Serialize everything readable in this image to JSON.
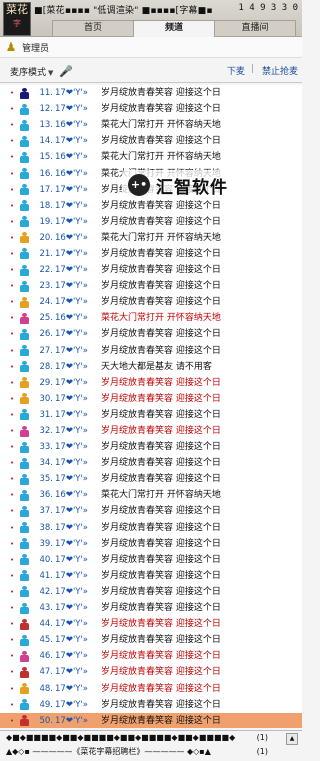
{
  "logo": {
    "text": "菜花",
    "sub": "字"
  },
  "room": {
    "title": "■[菜花▪▪▪▪ \"低调渲染\" ■▪▪▪▪[字幕■▪",
    "number": "1 4 9 3 3 0"
  },
  "tabs": [
    {
      "label": "首页",
      "active": false
    },
    {
      "label": "频道",
      "active": true
    },
    {
      "label": "直播间",
      "active": false
    }
  ],
  "admin": {
    "label": "管理员"
  },
  "toolbar": {
    "mode_label": "麦序模式",
    "down_label": "下麦",
    "ban_label": "禁止抢麦"
  },
  "rows": [
    {
      "num": "11.",
      "name": "17❤'Y'»",
      "sig": "岁月绽放青春笑容 迎接这个日",
      "color": "#1a1a7a",
      "red": false,
      "sel": false
    },
    {
      "num": "12.",
      "name": "17❤'Y'»",
      "sig": "岁月绽放青春笑容 迎接这个日",
      "color": "#2aa8d8",
      "red": false,
      "sel": false
    },
    {
      "num": "13.",
      "name": "16❤'Y'»",
      "sig": "菜花大门常打开 开怀容纳天地",
      "color": "#2aa8d8",
      "red": false,
      "sel": false
    },
    {
      "num": "14.",
      "name": "17❤'Y'»",
      "sig": "岁月绽放青春笑容 迎接这个日",
      "color": "#2aa8d8",
      "red": false,
      "sel": false
    },
    {
      "num": "15.",
      "name": "16❤'Y'»",
      "sig": "菜花大门常打开 开怀容纳天地",
      "color": "#2aa8d8",
      "red": false,
      "sel": false
    },
    {
      "num": "16.",
      "name": "16❤'Y'»",
      "sig": "菜花大门常打开 开怀容纳天地",
      "color": "#2aa8d8",
      "red": false,
      "sel": false
    },
    {
      "num": "17.",
      "name": "17❤'Y'»",
      "sig": "岁月绽放青春笑容 迎接这个日",
      "color": "#2aa8d8",
      "red": false,
      "sel": false
    },
    {
      "num": "18.",
      "name": "17❤'Y'»",
      "sig": "岁月绽放青春笑容 迎接这个日",
      "color": "#2aa8d8",
      "red": false,
      "sel": false
    },
    {
      "num": "19.",
      "name": "17❤'Y'»",
      "sig": "岁月绽放青春笑容 迎接这个日",
      "color": "#2aa8d8",
      "red": false,
      "sel": false
    },
    {
      "num": "20.",
      "name": "16❤'Y'»",
      "sig": "菜花大门常打开 开怀容纳天地",
      "color": "#e6a020",
      "red": false,
      "sel": false
    },
    {
      "num": "21.",
      "name": "17❤'Y'»",
      "sig": "岁月绽放青春笑容 迎接这个日",
      "color": "#2aa8d8",
      "red": false,
      "sel": false
    },
    {
      "num": "22.",
      "name": "17❤'Y'»",
      "sig": "岁月绽放青春笑容 迎接这个日",
      "color": "#2aa8d8",
      "red": false,
      "sel": false
    },
    {
      "num": "23.",
      "name": "17❤'Y'»",
      "sig": "岁月绽放青春笑容 迎接这个日",
      "color": "#2aa8d8",
      "red": false,
      "sel": false
    },
    {
      "num": "24.",
      "name": "17❤'Y'»",
      "sig": "岁月绽放青春笑容 迎接这个日",
      "color": "#e6a020",
      "red": false,
      "sel": false
    },
    {
      "num": "25.",
      "name": "16❤'Y'»",
      "sig": "菜花大门常打开 开怀容纳天地",
      "color": "#d04090",
      "red": true,
      "sel": false
    },
    {
      "num": "26.",
      "name": "17❤'Y'»",
      "sig": "岁月绽放青春笑容 迎接这个日",
      "color": "#2aa8d8",
      "red": false,
      "sel": false
    },
    {
      "num": "27.",
      "name": "17❤'Y'»",
      "sig": "岁月绽放青春笑容 迎接这个日",
      "color": "#2aa8d8",
      "red": false,
      "sel": false
    },
    {
      "num": "28.",
      "name": "17❤'Y'»",
      "sig": "天大地大都是基友 请不用客",
      "color": "#2aa8d8",
      "red": false,
      "sel": false
    },
    {
      "num": "29.",
      "name": "17❤'Y'»",
      "sig": "岁月绽放青春笑容 迎接这个日",
      "color": "#e6a020",
      "red": true,
      "sel": false
    },
    {
      "num": "30.",
      "name": "17❤'Y'»",
      "sig": "岁月绽放青春笑容 迎接这个日",
      "color": "#e6a020",
      "red": true,
      "sel": false
    },
    {
      "num": "31.",
      "name": "17❤'Y'»",
      "sig": "岁月绽放青春笑容 迎接这个日",
      "color": "#2aa8d8",
      "red": false,
      "sel": false
    },
    {
      "num": "32.",
      "name": "17❤'Y'»",
      "sig": "岁月绽放青春笑容 迎接这个日",
      "color": "#d04090",
      "red": true,
      "sel": false
    },
    {
      "num": "33.",
      "name": "17❤'Y'»",
      "sig": "岁月绽放青春笑容 迎接这个日",
      "color": "#2aa8d8",
      "red": false,
      "sel": false
    },
    {
      "num": "34.",
      "name": "17❤'Y'»",
      "sig": "岁月绽放青春笑容 迎接这个日",
      "color": "#2aa8d8",
      "red": false,
      "sel": false
    },
    {
      "num": "35.",
      "name": "17❤'Y'»",
      "sig": "岁月绽放青春笑容 迎接这个日",
      "color": "#2aa8d8",
      "red": false,
      "sel": false
    },
    {
      "num": "36.",
      "name": "16❤'Y'»",
      "sig": "菜花大门常打开 开怀容纳天地",
      "color": "#2aa8d8",
      "red": false,
      "sel": false
    },
    {
      "num": "37.",
      "name": "17❤'Y'»",
      "sig": "岁月绽放青春笑容 迎接这个日",
      "color": "#2aa8d8",
      "red": false,
      "sel": false
    },
    {
      "num": "38.",
      "name": "17❤'Y'»",
      "sig": "岁月绽放青春笑容 迎接这个日",
      "color": "#2aa8d8",
      "red": false,
      "sel": false
    },
    {
      "num": "39.",
      "name": "17❤'Y'»",
      "sig": "岁月绽放青春笑容 迎接这个日",
      "color": "#2aa8d8",
      "red": false,
      "sel": false
    },
    {
      "num": "40.",
      "name": "17❤'Y'»",
      "sig": "岁月绽放青春笑容 迎接这个日",
      "color": "#2aa8d8",
      "red": false,
      "sel": false
    },
    {
      "num": "41.",
      "name": "17❤'Y'»",
      "sig": "岁月绽放青春笑容 迎接这个日",
      "color": "#2aa8d8",
      "red": false,
      "sel": false
    },
    {
      "num": "42.",
      "name": "17❤'Y'»",
      "sig": "岁月绽放青春笑容 迎接这个日",
      "color": "#2aa8d8",
      "red": false,
      "sel": false
    },
    {
      "num": "43.",
      "name": "17❤'Y'»",
      "sig": "岁月绽放青春笑容 迎接这个日",
      "color": "#2aa8d8",
      "red": false,
      "sel": false
    },
    {
      "num": "44.",
      "name": "17❤'Y'»",
      "sig": "岁月绽放青春笑容 迎接这个日",
      "color": "#c03030",
      "red": true,
      "sel": false
    },
    {
      "num": "45.",
      "name": "17❤'Y'»",
      "sig": "岁月绽放青春笑容 迎接这个日",
      "color": "#2aa8d8",
      "red": false,
      "sel": false
    },
    {
      "num": "46.",
      "name": "17❤'Y'»",
      "sig": "岁月绽放青春笑容 迎接这个日",
      "color": "#d04090",
      "red": true,
      "sel": false
    },
    {
      "num": "47.",
      "name": "17❤'Y'»",
      "sig": "岁月绽放青春笑容 迎接这个日",
      "color": "#c03030",
      "red": true,
      "sel": false
    },
    {
      "num": "48.",
      "name": "17❤'Y'»",
      "sig": "岁月绽放青春笑容 迎接这个日",
      "color": "#e6a020",
      "red": true,
      "sel": false
    },
    {
      "num": "49.",
      "name": "17❤'Y'»",
      "sig": "岁月绽放青春笑容 迎接这个日",
      "color": "#2aa8d8",
      "red": false,
      "sel": false
    },
    {
      "num": "50.",
      "name": "17❤'Y'»",
      "sig": "岁月绽放青春笑容 迎接这个日",
      "color": "#c03030",
      "red": false,
      "sel": true
    }
  ],
  "watermark": {
    "text": "汇智软件"
  },
  "bottom": {
    "row1": "◆■◆■■■■◆■■◆■■■■◆■■◆■■■■◆■■◆■■■■◆",
    "row1_count": "(1)",
    "row2": "▲◆◇▪ —————《菜花字幕招聘栏》————— ◆◇▪▲",
    "row2_count": "(1)"
  },
  "colors": {
    "accent": "#1a55b0",
    "red": "#c00000",
    "selected": "#f0a06c"
  }
}
